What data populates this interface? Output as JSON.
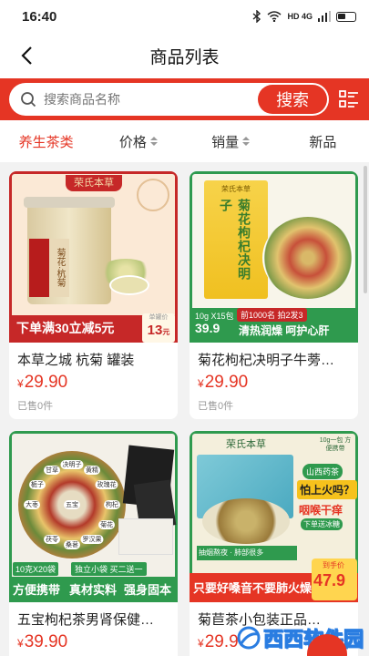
{
  "status": {
    "time": "16:40",
    "network": "HD 4G"
  },
  "nav": {
    "title": "商品列表"
  },
  "search": {
    "placeholder": "搜索商品名称",
    "button": "搜索"
  },
  "sort": [
    {
      "label": "养生茶类",
      "active": true
    },
    {
      "label": "价格"
    },
    {
      "label": "销量"
    },
    {
      "label": "新品"
    }
  ],
  "products": [
    {
      "name": "本草之城 杭菊 罐装",
      "currency": "¥",
      "price": "29.90",
      "sold": "已售0件",
      "img": {
        "brand": "荣氏本草",
        "jar_label": "菊花·杭菊",
        "banner": "下单满30立减5元",
        "tag_small": "单罐价",
        "tag_price": "13",
        "tag_unit": "元"
      }
    },
    {
      "name": "菊花枸杞决明子牛蒡…",
      "currency": "¥",
      "price": "29.90",
      "sold": "已售0件",
      "img": {
        "box_text": "菊花枸杞决明子",
        "brand": "荣氏本草",
        "spec": "10g X15包",
        "price": "39.9",
        "promo": "前1000名 拍2发3",
        "slogan": "清热润燥 呵护心肝"
      }
    },
    {
      "name": "五宝枸杞茶男肾保健…",
      "currency": "¥",
      "price": "39.90",
      "sold": "",
      "img": {
        "labels": [
          "决明子",
          "黄精",
          "玫瑰花",
          "枸杞",
          "菊花",
          "罗汉果",
          "桑葚",
          "茯苓",
          "五宝",
          "大枣",
          "栀子",
          "甘草"
        ],
        "spec": "10克X20袋",
        "promo": "独立小袋 买二送一",
        "slogan_left": "方便携带",
        "slogan_mid": "真材实料",
        "slogan_right": "强身固本"
      }
    },
    {
      "name": "菊苣茶小包装正品…",
      "currency": "¥",
      "price": "29.90",
      "sold": "",
      "img": {
        "brand": "荣氏本草",
        "top": "10g一包 方便携带",
        "badge": "山西药茶",
        "call1": "怕上火吗？",
        "call2": "咽喉干痒",
        "call3": "下单送冰糖",
        "strip": "抽烟熬夜 · 肺部很多",
        "slogan": "只要好嗓音不要肺火燥",
        "price_label": "到手价",
        "price": "47.9"
      }
    }
  ],
  "watermark": "西西软件园",
  "colors": {
    "accent": "#e53524",
    "green": "#2f9a4e"
  },
  "icons": [
    "back-arrow-icon",
    "search-icon",
    "grid-toggle-icon",
    "sort-caret-icon"
  ]
}
